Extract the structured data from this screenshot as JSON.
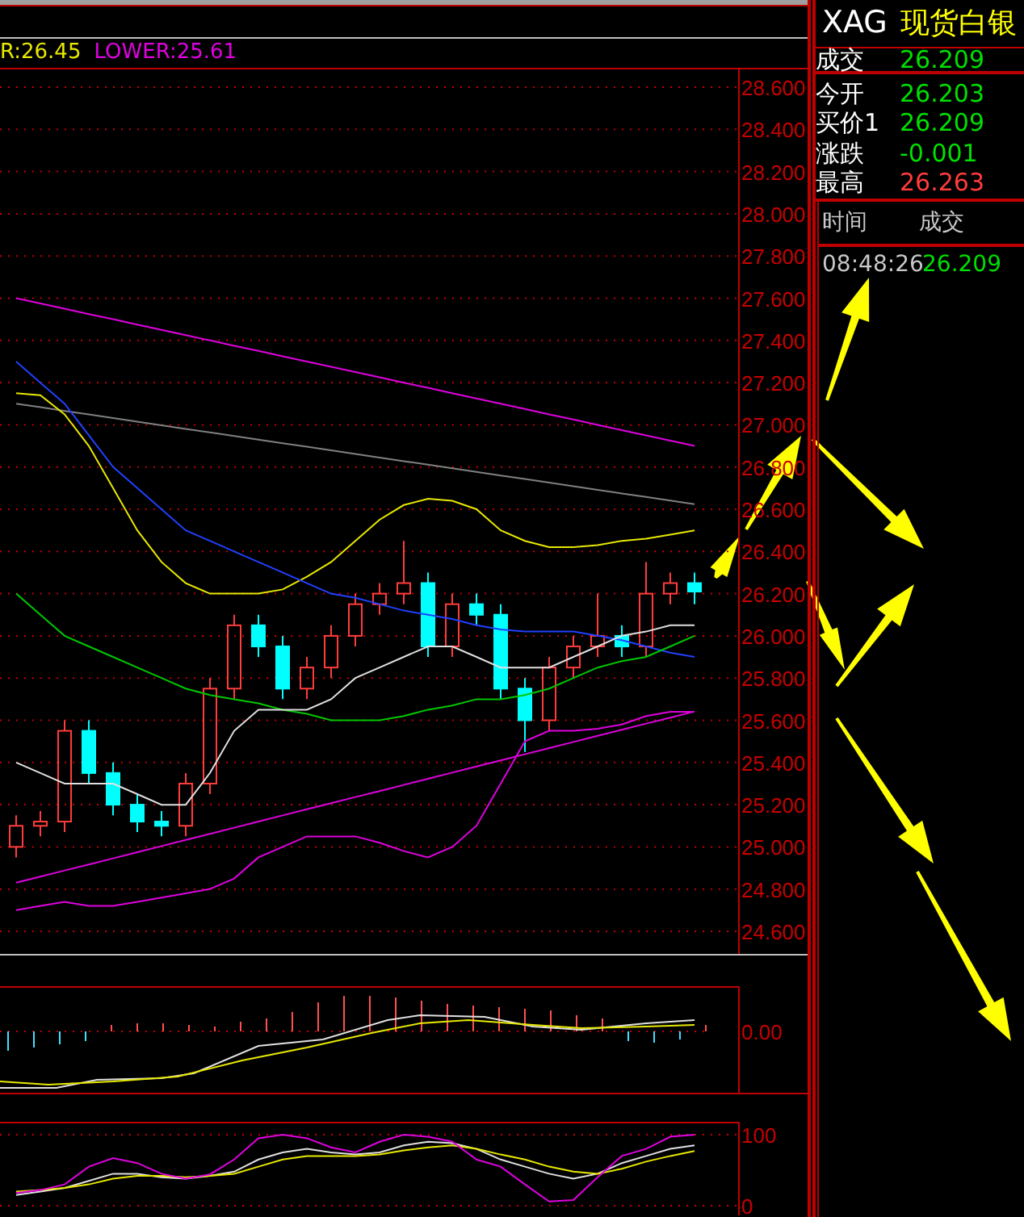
{
  "indicator_header": [
    {
      "text": "R:26.45",
      "color": "#e8e800"
    },
    {
      "text": "LOWER:25.61",
      "color": "#e000e0"
    }
  ],
  "main_chart": {
    "chart_data": {
      "type": "candlestick",
      "grid": true,
      "ylim": [
        24.5,
        28.7
      ],
      "yticks": [
        {
          "value": 28.6,
          "label": "28.600"
        },
        {
          "value": 28.4,
          "label": "28.400"
        },
        {
          "value": 28.2,
          "label": "28.200"
        },
        {
          "value": 28.0,
          "label": "28.000"
        },
        {
          "value": 27.8,
          "label": "27.800"
        },
        {
          "value": 27.6,
          "label": "27.600"
        },
        {
          "value": 27.4,
          "label": "27.400"
        },
        {
          "value": 27.2,
          "label": "27.200"
        },
        {
          "value": 27.0,
          "label": "27.000"
        },
        {
          "value": 26.8,
          "label": "26.800"
        },
        {
          "value": 26.6,
          "label": "26.600"
        },
        {
          "value": 26.4,
          "label": "26.400"
        },
        {
          "value": 26.2,
          "label": "26.200"
        },
        {
          "value": 26.0,
          "label": "26.000"
        },
        {
          "value": 25.8,
          "label": "25.800"
        },
        {
          "value": 25.6,
          "label": "25.600"
        },
        {
          "value": 25.4,
          "label": "25.400"
        },
        {
          "value": 25.2,
          "label": "25.200"
        },
        {
          "value": 25.0,
          "label": "25.000"
        },
        {
          "value": 24.8,
          "label": "24.800"
        },
        {
          "value": 24.6,
          "label": "24.600"
        }
      ],
      "ohlc": [
        [
          25.0,
          25.15,
          24.95,
          25.1
        ],
        [
          25.1,
          25.17,
          25.05,
          25.12
        ],
        [
          25.12,
          25.6,
          25.07,
          25.55
        ],
        [
          25.55,
          25.6,
          25.3,
          25.35
        ],
        [
          25.35,
          25.4,
          25.15,
          25.2
        ],
        [
          25.2,
          25.25,
          25.07,
          25.12
        ],
        [
          25.12,
          25.17,
          25.05,
          25.1
        ],
        [
          25.1,
          25.35,
          25.05,
          25.3
        ],
        [
          25.3,
          25.8,
          25.25,
          25.75
        ],
        [
          25.75,
          26.1,
          25.7,
          26.05
        ],
        [
          26.05,
          26.1,
          25.9,
          25.95
        ],
        [
          25.95,
          26.0,
          25.7,
          25.75
        ],
        [
          25.75,
          25.9,
          25.7,
          25.85
        ],
        [
          25.85,
          26.05,
          25.8,
          26.0
        ],
        [
          26.0,
          26.2,
          25.95,
          26.15
        ],
        [
          26.15,
          26.25,
          26.1,
          26.2
        ],
        [
          26.2,
          26.45,
          26.15,
          26.25
        ],
        [
          26.25,
          26.3,
          25.9,
          25.95
        ],
        [
          25.95,
          26.2,
          25.9,
          26.15
        ],
        [
          26.15,
          26.2,
          26.05,
          26.1
        ],
        [
          26.1,
          26.15,
          25.7,
          25.75
        ],
        [
          25.75,
          25.8,
          25.45,
          25.6
        ],
        [
          25.6,
          25.9,
          25.55,
          25.85
        ],
        [
          25.85,
          26.0,
          25.8,
          25.95
        ],
        [
          25.95,
          26.2,
          25.9,
          26.0
        ],
        [
          26.0,
          26.05,
          25.9,
          25.95
        ],
        [
          25.95,
          26.35,
          25.9,
          26.2
        ],
        [
          26.2,
          26.3,
          26.15,
          26.25
        ],
        [
          26.25,
          26.3,
          26.15,
          26.21
        ]
      ],
      "series": [
        {
          "type": "line",
          "color": "#808080",
          "values": [
            27.1,
            27.083,
            27.066,
            27.049,
            27.032,
            27.015,
            26.998,
            26.981,
            26.964,
            26.947,
            26.93,
            26.913,
            26.896,
            26.879,
            26.862,
            26.845,
            26.828,
            26.811,
            26.794,
            26.777,
            26.76,
            26.743,
            26.726,
            26.709,
            26.692,
            26.675,
            26.658,
            26.641,
            26.624
          ]
        },
        {
          "type": "line",
          "color": "#e000e0",
          "values": [
            27.6,
            27.575,
            27.55,
            27.525,
            27.5,
            27.475,
            27.45,
            27.425,
            27.4,
            27.375,
            27.35,
            27.325,
            27.3,
            27.275,
            27.25,
            27.225,
            27.2,
            27.175,
            27.15,
            27.125,
            27.1,
            27.075,
            27.05,
            27.025,
            27.0,
            26.975,
            26.95,
            26.925,
            26.9
          ]
        },
        {
          "type": "line",
          "color": "#e8e800",
          "values": [
            27.15,
            27.14,
            27.05,
            26.9,
            26.7,
            26.5,
            26.35,
            26.25,
            26.2,
            26.2,
            26.2,
            26.22,
            26.28,
            26.35,
            26.45,
            26.55,
            26.62,
            26.65,
            26.64,
            26.6,
            26.5,
            26.45,
            26.42,
            26.42,
            26.43,
            26.45,
            26.46,
            26.48,
            26.5
          ]
        },
        {
          "type": "line",
          "color": "#2040ff",
          "values": [
            27.3,
            27.2,
            27.1,
            26.95,
            26.8,
            26.7,
            26.6,
            26.5,
            26.45,
            26.4,
            26.35,
            26.3,
            26.25,
            26.2,
            26.18,
            26.15,
            26.12,
            26.1,
            26.08,
            26.05,
            26.03,
            26.02,
            26.02,
            26.02,
            26.0,
            25.98,
            25.95,
            25.92,
            25.9
          ]
        },
        {
          "type": "line",
          "color": "#00c800",
          "values": [
            26.2,
            26.1,
            26.0,
            25.95,
            25.9,
            25.85,
            25.8,
            25.75,
            25.72,
            25.7,
            25.68,
            25.65,
            25.63,
            25.6,
            25.6,
            25.6,
            25.62,
            25.65,
            25.67,
            25.7,
            25.7,
            25.72,
            25.75,
            25.8,
            25.85,
            25.88,
            25.9,
            25.95,
            26.0
          ]
        },
        {
          "type": "line",
          "color": "#e0e0e0",
          "values": [
            25.4,
            25.35,
            25.3,
            25.3,
            25.3,
            25.25,
            25.2,
            25.2,
            25.35,
            25.55,
            25.65,
            25.65,
            25.65,
            25.7,
            25.8,
            25.85,
            25.9,
            25.95,
            25.95,
            25.9,
            25.85,
            25.85,
            25.85,
            25.9,
            25.95,
            26.0,
            26.02,
            26.05,
            26.05
          ]
        },
        {
          "type": "line",
          "color": "#e000e0",
          "values": [
            24.7,
            24.72,
            24.74,
            24.72,
            24.72,
            24.74,
            24.76,
            24.78,
            24.8,
            24.85,
            24.95,
            25.0,
            25.05,
            25.05,
            25.05,
            25.02,
            24.98,
            24.95,
            25.0,
            25.1,
            25.3,
            25.5,
            25.55,
            25.55,
            25.56,
            25.58,
            25.62,
            25.64,
            25.64
          ]
        },
        {
          "type": "line",
          "color": "#e000e0",
          "values": [
            24.83,
            24.859,
            24.888,
            24.917,
            24.946,
            24.975,
            25.004,
            25.033,
            25.062,
            25.091,
            25.12,
            25.149,
            25.178,
            25.207,
            25.236,
            25.265,
            25.294,
            25.323,
            25.352,
            25.381,
            25.41,
            25.439,
            25.468,
            25.497,
            25.526,
            25.555,
            25.584,
            25.613,
            25.642
          ]
        }
      ]
    }
  },
  "macd_axis_label": "0.00",
  "kdj_chart": {
    "chart_data": {
      "type": "line",
      "ylim": [
        0,
        100
      ],
      "yticks": [
        100,
        0
      ],
      "series": [
        {
          "color": "#e0e0e0",
          "values": [
            15,
            20,
            25,
            35,
            45,
            45,
            40,
            38,
            42,
            48,
            65,
            75,
            80,
            75,
            72,
            75,
            85,
            90,
            88,
            80,
            65,
            55,
            45,
            38,
            45,
            60,
            70,
            80,
            85
          ]
        },
        {
          "color": "#e8e800",
          "values": [
            20,
            22,
            25,
            30,
            38,
            42,
            42,
            40,
            42,
            45,
            55,
            65,
            70,
            70,
            70,
            72,
            78,
            82,
            85,
            80,
            72,
            65,
            55,
            48,
            45,
            52,
            62,
            70,
            77
          ]
        },
        {
          "color": "#e000e0",
          "values": [
            18,
            22,
            30,
            55,
            67,
            60,
            45,
            38,
            44,
            65,
            95,
            100,
            95,
            82,
            75,
            90,
            100,
            97,
            90,
            65,
            55,
            30,
            6,
            8,
            40,
            70,
            80,
            97,
            100
          ]
        }
      ]
    }
  },
  "quote_panel": {
    "symbol": "XAG",
    "name": "现货白银",
    "last": {
      "label": "成交",
      "value": "26.209",
      "color": "#00e000"
    },
    "fields": [
      {
        "label": "今开",
        "value": "26.203",
        "color": "#00e000"
      },
      {
        "label": "买价1",
        "value": "26.209",
        "color": "#00e000"
      },
      {
        "label": "涨跌",
        "value": "-0.001",
        "color": "#00e000"
      },
      {
        "label": "最高",
        "value": "26.263",
        "color": "#ff3c3c"
      }
    ],
    "ticks_header": [
      "时间",
      "成交"
    ],
    "ticks": [
      {
        "time": "08:48:26",
        "price": "26.209",
        "color": "#00e000"
      }
    ]
  }
}
